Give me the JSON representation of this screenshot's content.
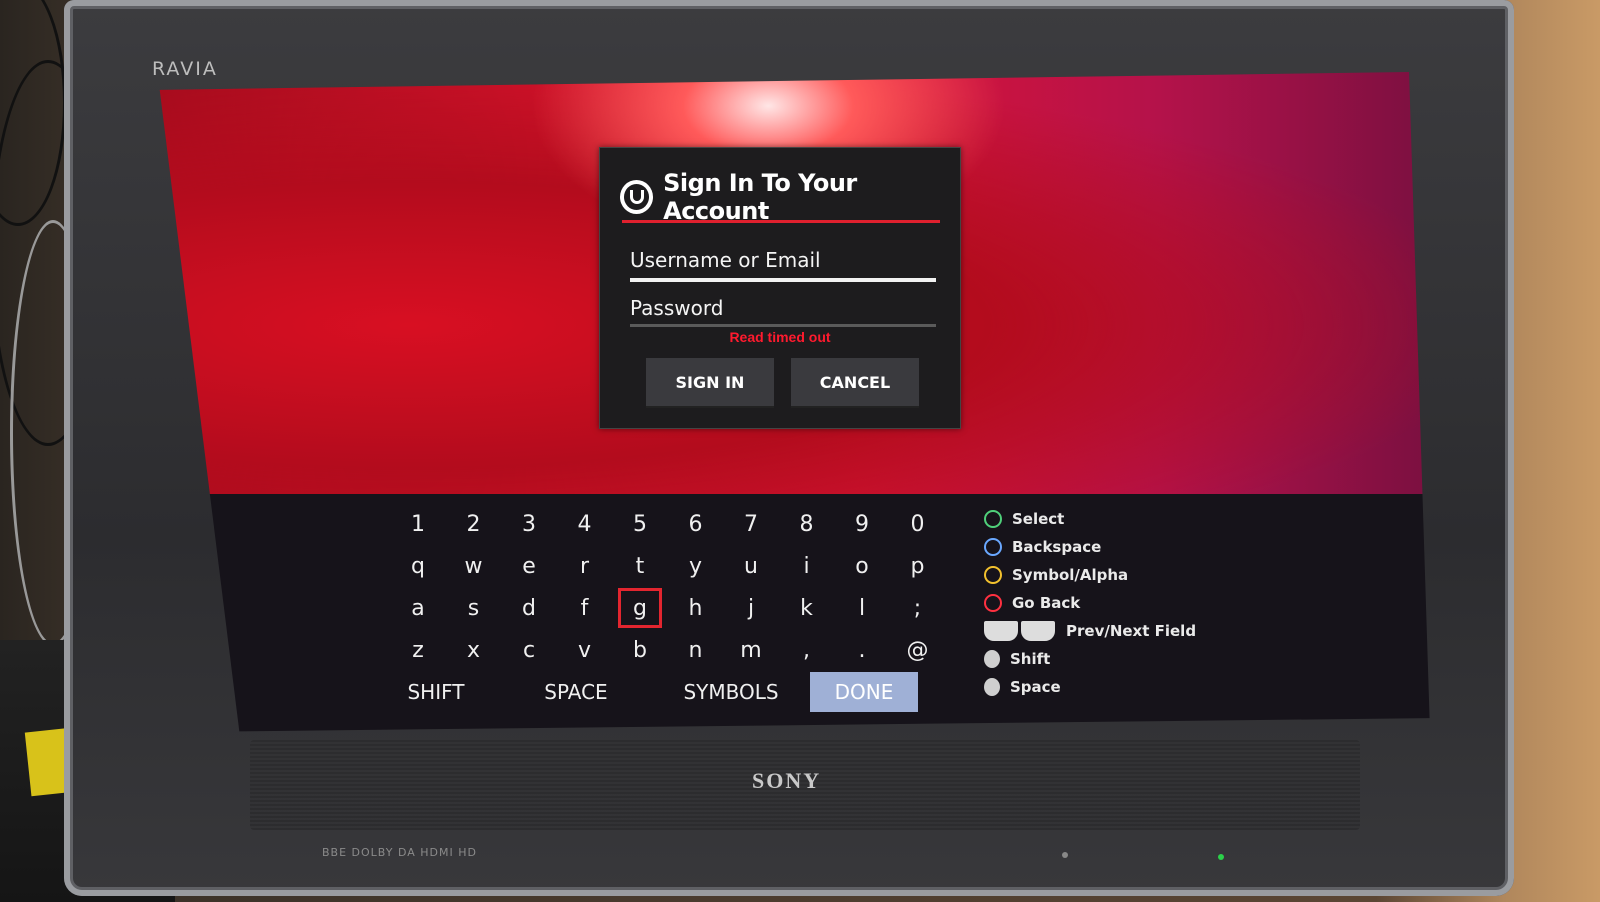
{
  "tv": {
    "top_brand": "RAVIA",
    "logo": "SONY",
    "bottom_badges": "BBE  DOLBY  DA  HDMI  HD"
  },
  "dialog": {
    "title": "Sign In To Your Account",
    "brand_icon": "u-logo-icon",
    "username_placeholder": "Username or Email",
    "password_placeholder": "Password",
    "error": "Read timed out",
    "signin_label": "SIGN IN",
    "cancel_label": "CANCEL"
  },
  "keyboard": {
    "rows": [
      [
        "1",
        "2",
        "3",
        "4",
        "5",
        "6",
        "7",
        "8",
        "9",
        "0"
      ],
      [
        "q",
        "w",
        "e",
        "r",
        "t",
        "y",
        "u",
        "i",
        "o",
        "p"
      ],
      [
        "a",
        "s",
        "d",
        "f",
        "g",
        "h",
        "j",
        "k",
        "l",
        ";"
      ],
      [
        "z",
        "x",
        "c",
        "v",
        "b",
        "n",
        "m",
        ",",
        ".",
        "@"
      ]
    ],
    "selected_key": "g",
    "actions": [
      "SHIFT",
      "SPACE",
      "SYMBOLS",
      "DONE"
    ],
    "highlighted_action": "DONE"
  },
  "legend": [
    {
      "icon": "select-icon",
      "color": "#4fd07a",
      "label": "Select"
    },
    {
      "icon": "backspace-icon",
      "color": "#6aa8ff",
      "label": "Backspace"
    },
    {
      "icon": "symbol-alpha-icon",
      "color": "#f2c12e",
      "label": "Symbol/Alpha"
    },
    {
      "icon": "go-back-icon",
      "color": "#ff3040",
      "label": "Go Back"
    },
    {
      "icon": "shoulder-buttons-icon",
      "color": "#dddddd",
      "label": "Prev/Next Field"
    },
    {
      "icon": "left-stick-icon",
      "color": "#cfcfcf",
      "label": "Shift"
    },
    {
      "icon": "right-stick-icon",
      "color": "#cfcfcf",
      "label": "Space"
    }
  ],
  "colors": {
    "accent_red": "#e0202e",
    "error_red": "#ff1a2e",
    "done_highlight": "#9fb0d6"
  }
}
